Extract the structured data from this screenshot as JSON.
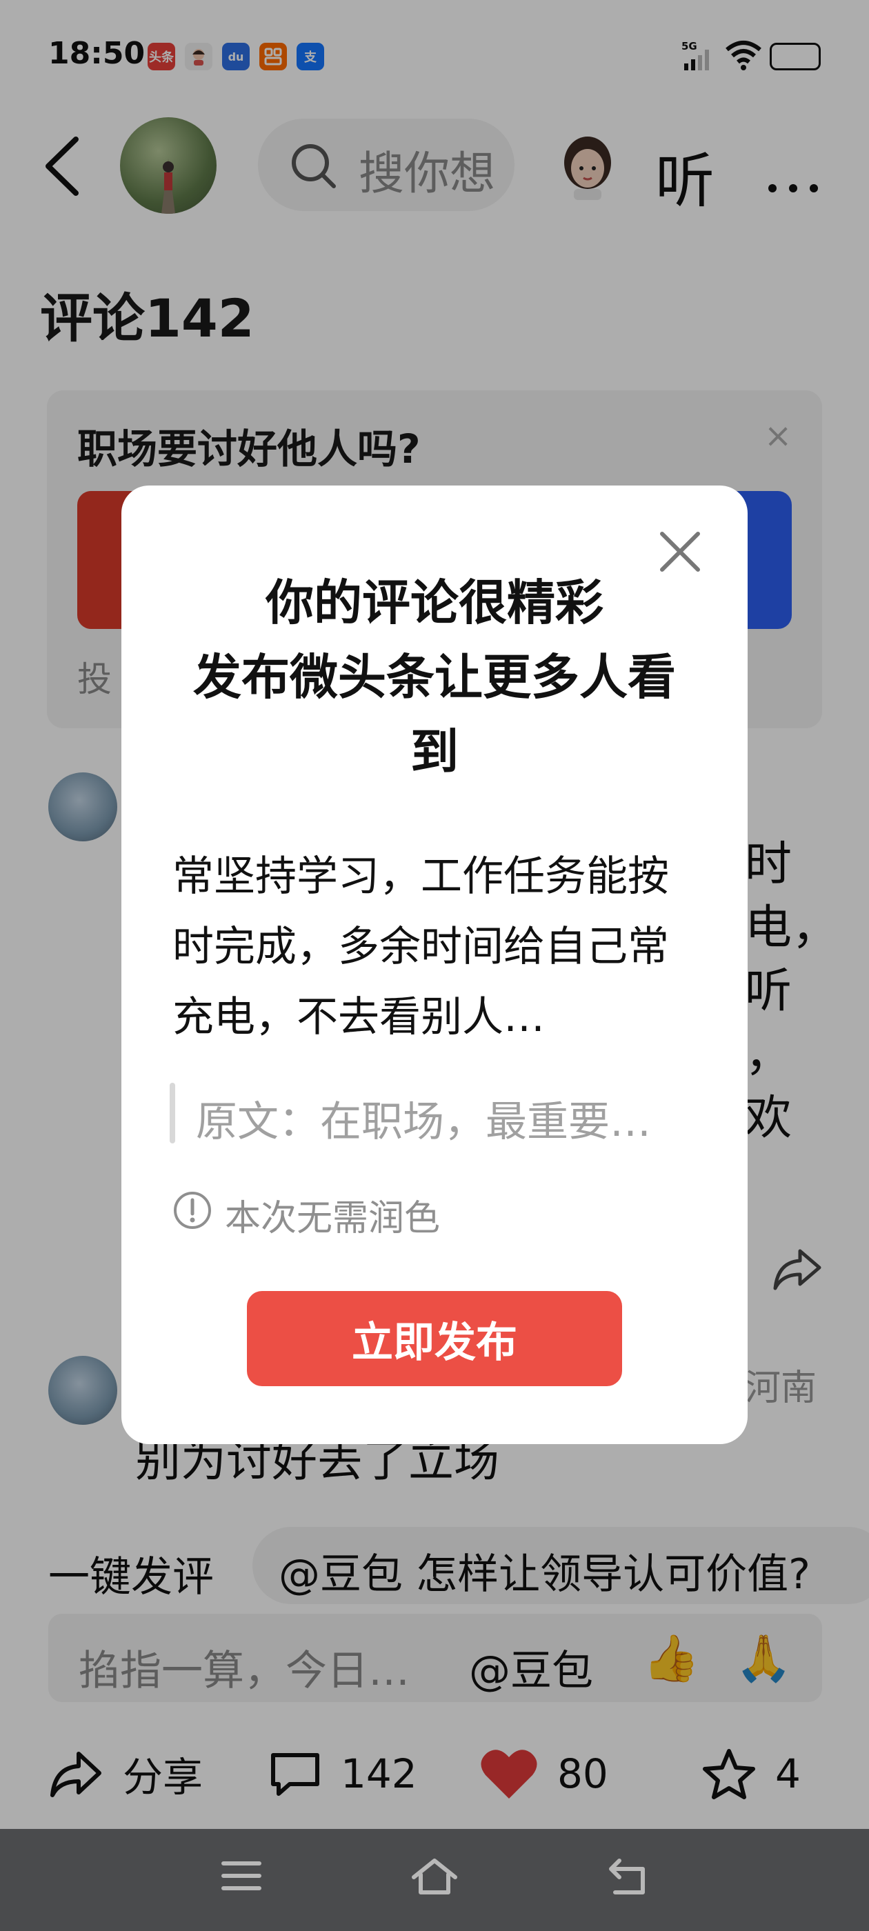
{
  "status_bar": {
    "time": "18:50",
    "network": "5G",
    "app_icons": [
      {
        "name": "toutiao-icon",
        "label": "头条",
        "color": "#e8403a"
      },
      {
        "name": "doubao-icon",
        "label": "",
        "color": "#f0f0f0"
      },
      {
        "name": "baidu-icon",
        "label": "du",
        "color": "#2f6fe4"
      },
      {
        "name": "taobao-icon",
        "label": "",
        "color": "#ff6a00"
      },
      {
        "name": "alipay-icon",
        "label": "支",
        "color": "#1677ff"
      }
    ]
  },
  "top_bar": {
    "search_placeholder": "搜你想",
    "listen_label": "听"
  },
  "page": {
    "comments_title": "评论142",
    "vote": {
      "question": "职场要讨好他人吗?",
      "hint": "投",
      "close": "×"
    },
    "comment1_visible_text": "时\n电，\n听\n，\n欢",
    "comment2_location": "河南",
    "comment2_text": "别为讨好丢了立场"
  },
  "bottom": {
    "quick_comment_label": "一键发评",
    "suggestion": "@豆包 怎样让领导认可价值?",
    "input_placeholder": "掐指一算，今日…",
    "at_label": "@豆包",
    "emoji_thumb": "👍",
    "emoji_pray": "🙏",
    "actions": {
      "share_label": "分享",
      "comments_count": "142",
      "likes_count": "80",
      "favorites_count": "4"
    }
  },
  "modal": {
    "title": "你的评论很精彩\n发布微头条让更多人看\n到",
    "body": "常坚持学习，工作任务能按时完成，多余时间给自己常充电，不去看别人…",
    "quote": "原文：在职场，最重要…",
    "info": "本次无需润色",
    "publish_button": "立即发布"
  },
  "colors": {
    "accent_red": "#ec4f45",
    "like_red": "#e03a3a",
    "vote_red": "#d93a2a",
    "vote_blue": "#2d5ff0"
  }
}
